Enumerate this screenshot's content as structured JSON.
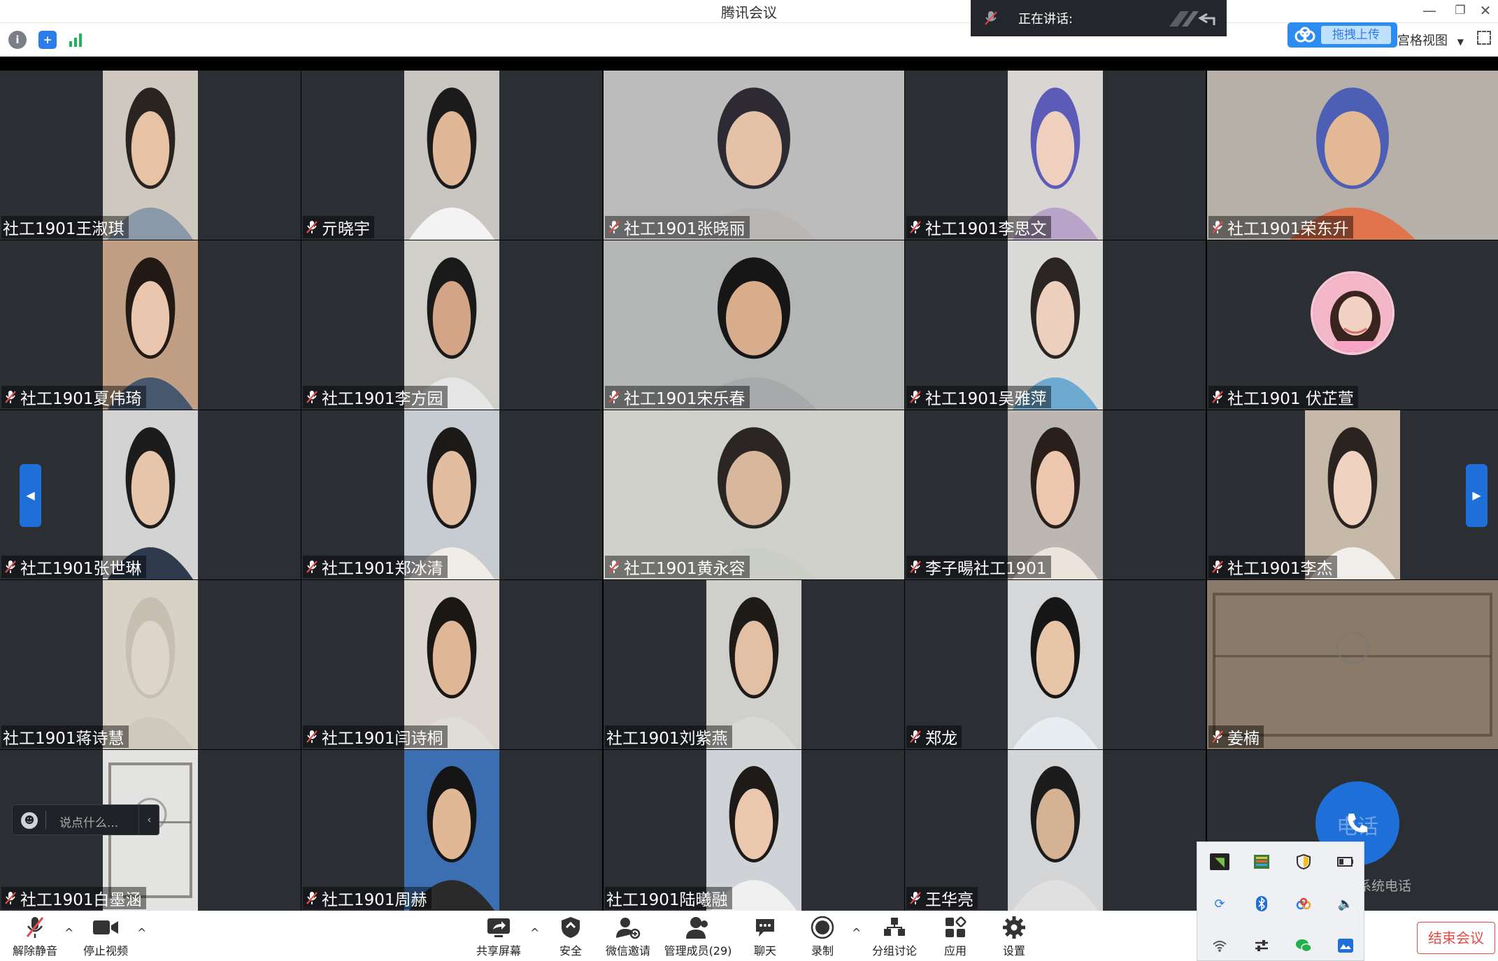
{
  "window": {
    "title": "腾讯会议"
  },
  "speaking": {
    "label": "正在讲话:"
  },
  "upload": {
    "label": "拖拽上传"
  },
  "view": {
    "label": "宫格视图"
  },
  "colors": {
    "accent": "#1f6fd8",
    "danger": "#e64a45",
    "tile_bg": "#2b2e33"
  },
  "tiles": [
    {
      "name": "社工1901王淑琪",
      "muted": false,
      "bg": "#cfc8be",
      "face": "#e8c2a4",
      "hair": "#2a2420",
      "cloth": "#8b98a8",
      "wide": false
    },
    {
      "name": "亓晓宇",
      "muted": true,
      "bg": "#c9c6c2",
      "face": "#e0b898",
      "hair": "#1b1b1b",
      "cloth": "#f3f3f3",
      "wide": false
    },
    {
      "name": "社工1901张晓丽",
      "muted": true,
      "bg": "#bcbcbc",
      "face": "#e5c1a8",
      "hair": "#2d2a33",
      "cloth": "#b9b6b3",
      "wide": true
    },
    {
      "name": "社工1901李思文",
      "muted": true,
      "bg": "#d8d5d3",
      "face": "#efcfbd",
      "hair": "#5c5bb7",
      "cloth": "#b8a4c9",
      "wide": false
    },
    {
      "name": "社工1901荣东升",
      "muted": true,
      "bg": "#b6b0a8",
      "face": "#e3b894",
      "hair": "#4c5fb5",
      "cloth": "#e0744d",
      "wide": true
    },
    {
      "name": "社工1901夏伟琦",
      "muted": true,
      "bg": "#c09f84",
      "face": "#e9c6ad",
      "hair": "#231a15",
      "cloth": "#47586e",
      "wide": false
    },
    {
      "name": "社工1901李方园",
      "muted": true,
      "bg": "#d1cfc9",
      "face": "#d4a486",
      "hair": "#1a1a1a",
      "cloth": "#e6e6e6",
      "wide": false
    },
    {
      "name": "社工1901宋乐春",
      "muted": true,
      "bg": "#b4b6b6",
      "face": "#d7ad8c",
      "hair": "#161616",
      "cloth": "#a7a9ab",
      "wide": true
    },
    {
      "name": "社工1901吴雅萍",
      "muted": true,
      "bg": "#dadad9",
      "face": "#ecd0bd",
      "hair": "#2a2522",
      "cloth": "#6ea9cf",
      "wide": false
    },
    {
      "name": "社工1901 伏芷萱",
      "muted": true,
      "avatar": true
    },
    {
      "name": "社工1901张世琳",
      "muted": true,
      "bg": "#d3d3d3",
      "face": "#e6c5aa",
      "hair": "#1c1c1c",
      "cloth": "#2f3a4d",
      "wide": false
    },
    {
      "name": "社工1901郑冰清",
      "muted": true,
      "bg": "#c6ccd2",
      "face": "#e2bd9f",
      "hair": "#1c1a19",
      "cloth": "#f0ede8",
      "wide": false
    },
    {
      "name": "社工1901黄永容",
      "muted": true,
      "bg": "#cfd1ca",
      "face": "#d9b79c",
      "hair": "#2b2623",
      "cloth": "#cbcfc6",
      "wide": true
    },
    {
      "name": "李子暘社工1901",
      "muted": true,
      "bg": "#bcb7b2",
      "face": "#ecc7ad",
      "hair": "#2a1f1a",
      "cloth": "#ece4da",
      "wide": false
    },
    {
      "name": "社工1901李杰",
      "muted": true,
      "bg": "#c7b9a7",
      "face": "#f0d2c1",
      "hair": "#2b2320",
      "cloth": "#f1eee9",
      "wide": false
    },
    {
      "name": "社工1901蒋诗慧",
      "muted": false,
      "bg": "#d8d1c6",
      "face": "#ddd5ca",
      "hair": "#c8bfb3",
      "cloth": "#cfc8bd",
      "wide": false
    },
    {
      "name": "社工1901闫诗桐",
      "muted": true,
      "bg": "#dad6cf",
      "face": "#dfb796",
      "hair": "#1b1714",
      "cloth": "#e0dcd6",
      "wide": false
    },
    {
      "name": "社工1901刘紫燕",
      "muted": false,
      "bg": "#cfd0cb",
      "face": "#e3c0a4",
      "hair": "#1f1b18",
      "cloth": "#d8d9d6",
      "wide": false
    },
    {
      "name": "郑龙",
      "muted": true,
      "bg": "#d5d7d9",
      "face": "#e9c5a8",
      "hair": "#171717",
      "cloth": "#e8edf1",
      "wide": false
    },
    {
      "name": "姜楠",
      "muted": true,
      "bg": "#8a7a69",
      "face": "#8a7a69",
      "hair": "#8a7a69",
      "cloth": "#8a7a69",
      "wide": true,
      "room": true
    },
    {
      "name": "社工1901白墨涵",
      "muted": true,
      "bg": "#e3e3e1",
      "face": "#e3e3e1",
      "hair": "#e3e3e1",
      "cloth": "#e3e3e1",
      "wide": false,
      "room": true
    },
    {
      "name": "社工1901周赫",
      "muted": true,
      "bg": "#3b6fb2",
      "face": "#e1b895",
      "hair": "#151515",
      "cloth": "#2a2a2a",
      "wide": false
    },
    {
      "name": "社工1901陆曦融",
      "muted": false,
      "bg": "#cfd2d6",
      "face": "#ebc7ad",
      "hair": "#1d1a18",
      "cloth": "#f0f0f0",
      "wide": false
    },
    {
      "name": "王华亮",
      "muted": true,
      "bg": "#d3d5d6",
      "face": "#d6b294",
      "hair": "#1c1c1c",
      "cloth": "#e0e0e0",
      "wide": false
    },
    {
      "name": "",
      "empty": true
    }
  ],
  "chat": {
    "placeholder": "说点什么..."
  },
  "call": {
    "icon_text": "电话",
    "caption": "系统电话"
  },
  "toolbar": {
    "unmute": "解除静音",
    "stop_video": "停止视频",
    "share": "共享屏幕",
    "security": "安全",
    "invite": "微信邀请",
    "members": "管理成员(29)",
    "chat": "聊天",
    "record": "录制",
    "breakout": "分组讨论",
    "apps": "应用",
    "settings": "设置",
    "end": "结束会议"
  }
}
